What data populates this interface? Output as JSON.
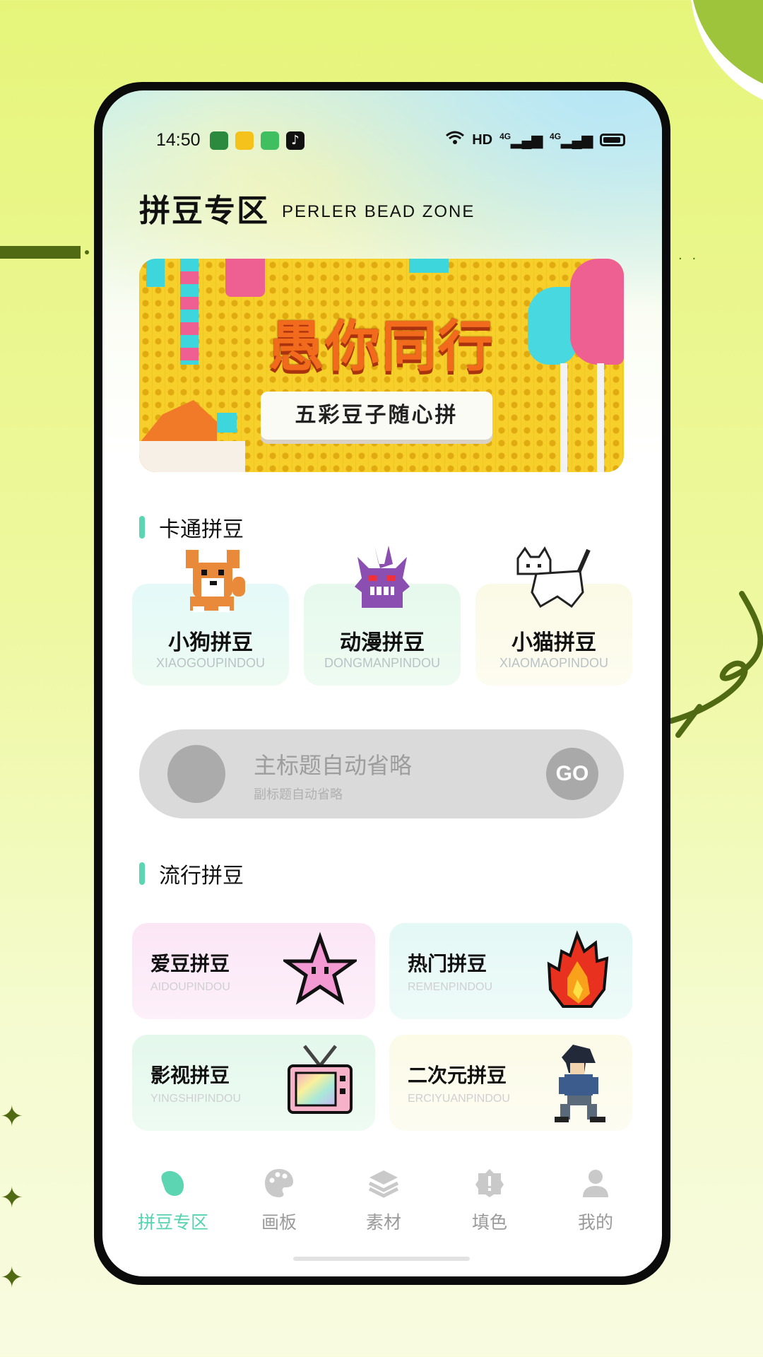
{
  "status_bar": {
    "time": "14:50",
    "network": "HD",
    "signal_1": "4G",
    "signal_2": "4G"
  },
  "header": {
    "title": "拼豆专区",
    "subtitle": "PERLER BEAD ZONE"
  },
  "banner": {
    "headline": "愚你同行",
    "pill": "五彩豆子随心拼"
  },
  "cartoon_section": {
    "title": "卡通拼豆",
    "items": [
      {
        "title": "小狗拼豆",
        "subtitle": "XIAOGOUPINDOU",
        "icon": "dog-icon",
        "bg": "#e6f9f8"
      },
      {
        "title": "动漫拼豆",
        "subtitle": "DONGMANPINDOU",
        "icon": "gengar-icon",
        "bg": "#e7f9ec"
      },
      {
        "title": "小猫拼豆",
        "subtitle": "XIAOMAOPINDOU",
        "icon": "cat-icon",
        "bg": "#fbfae8"
      }
    ]
  },
  "go_bar": {
    "title": "主标题自动省略",
    "subtitle": "副标题自动省略",
    "button": "GO"
  },
  "popular_section": {
    "title": "流行拼豆",
    "items": [
      {
        "title": "爱豆拼豆",
        "subtitle": "AIDOUPINDOU",
        "icon": "star-icon",
        "bg": "#fbe8f7"
      },
      {
        "title": "热门拼豆",
        "subtitle": "REMENPINDOU",
        "icon": "fire-icon",
        "bg": "#e6f8f6"
      },
      {
        "title": "影视拼豆",
        "subtitle": "YINGSHIPINDOU",
        "icon": "tv-icon",
        "bg": "#e5f8ec"
      },
      {
        "title": "二次元拼豆",
        "subtitle": "ERCIYUANPINDOU",
        "icon": "ninja-icon",
        "bg": "#fcfbea"
      }
    ]
  },
  "tabbar": {
    "items": [
      {
        "label": "拼豆专区",
        "icon": "bean-icon",
        "active": true
      },
      {
        "label": "画板",
        "icon": "palette-icon",
        "active": false
      },
      {
        "label": "素材",
        "icon": "layers-icon",
        "active": false
      },
      {
        "label": "填色",
        "icon": "badge-icon",
        "active": false
      },
      {
        "label": "我的",
        "icon": "person-icon",
        "active": false
      }
    ]
  },
  "colors": {
    "accent": "#55d3b1",
    "banner_yellow": "#f6cf2a",
    "headline_orange": "#f26a1b",
    "background_lime": "#e6f57a"
  }
}
